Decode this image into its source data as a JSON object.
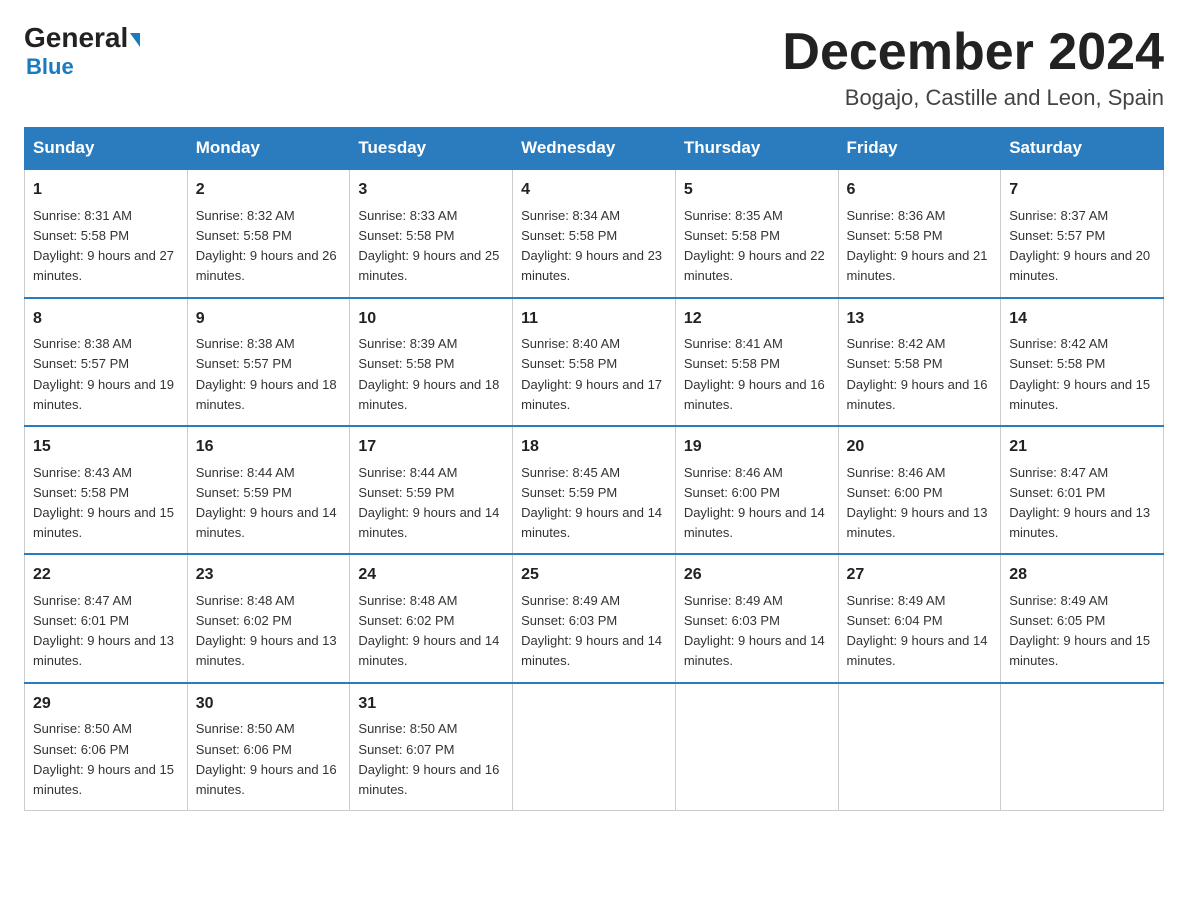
{
  "header": {
    "logo_general": "General",
    "logo_blue": "Blue",
    "month_year": "December 2024",
    "location": "Bogajo, Castille and Leon, Spain"
  },
  "days_of_week": [
    "Sunday",
    "Monday",
    "Tuesday",
    "Wednesday",
    "Thursday",
    "Friday",
    "Saturday"
  ],
  "weeks": [
    [
      {
        "day": "1",
        "sunrise": "8:31 AM",
        "sunset": "5:58 PM",
        "daylight": "9 hours and 27 minutes."
      },
      {
        "day": "2",
        "sunrise": "8:32 AM",
        "sunset": "5:58 PM",
        "daylight": "9 hours and 26 minutes."
      },
      {
        "day": "3",
        "sunrise": "8:33 AM",
        "sunset": "5:58 PM",
        "daylight": "9 hours and 25 minutes."
      },
      {
        "day": "4",
        "sunrise": "8:34 AM",
        "sunset": "5:58 PM",
        "daylight": "9 hours and 23 minutes."
      },
      {
        "day": "5",
        "sunrise": "8:35 AM",
        "sunset": "5:58 PM",
        "daylight": "9 hours and 22 minutes."
      },
      {
        "day": "6",
        "sunrise": "8:36 AM",
        "sunset": "5:58 PM",
        "daylight": "9 hours and 21 minutes."
      },
      {
        "day": "7",
        "sunrise": "8:37 AM",
        "sunset": "5:57 PM",
        "daylight": "9 hours and 20 minutes."
      }
    ],
    [
      {
        "day": "8",
        "sunrise": "8:38 AM",
        "sunset": "5:57 PM",
        "daylight": "9 hours and 19 minutes."
      },
      {
        "day": "9",
        "sunrise": "8:38 AM",
        "sunset": "5:57 PM",
        "daylight": "9 hours and 18 minutes."
      },
      {
        "day": "10",
        "sunrise": "8:39 AM",
        "sunset": "5:58 PM",
        "daylight": "9 hours and 18 minutes."
      },
      {
        "day": "11",
        "sunrise": "8:40 AM",
        "sunset": "5:58 PM",
        "daylight": "9 hours and 17 minutes."
      },
      {
        "day": "12",
        "sunrise": "8:41 AM",
        "sunset": "5:58 PM",
        "daylight": "9 hours and 16 minutes."
      },
      {
        "day": "13",
        "sunrise": "8:42 AM",
        "sunset": "5:58 PM",
        "daylight": "9 hours and 16 minutes."
      },
      {
        "day": "14",
        "sunrise": "8:42 AM",
        "sunset": "5:58 PM",
        "daylight": "9 hours and 15 minutes."
      }
    ],
    [
      {
        "day": "15",
        "sunrise": "8:43 AM",
        "sunset": "5:58 PM",
        "daylight": "9 hours and 15 minutes."
      },
      {
        "day": "16",
        "sunrise": "8:44 AM",
        "sunset": "5:59 PM",
        "daylight": "9 hours and 14 minutes."
      },
      {
        "day": "17",
        "sunrise": "8:44 AM",
        "sunset": "5:59 PM",
        "daylight": "9 hours and 14 minutes."
      },
      {
        "day": "18",
        "sunrise": "8:45 AM",
        "sunset": "5:59 PM",
        "daylight": "9 hours and 14 minutes."
      },
      {
        "day": "19",
        "sunrise": "8:46 AM",
        "sunset": "6:00 PM",
        "daylight": "9 hours and 14 minutes."
      },
      {
        "day": "20",
        "sunrise": "8:46 AM",
        "sunset": "6:00 PM",
        "daylight": "9 hours and 13 minutes."
      },
      {
        "day": "21",
        "sunrise": "8:47 AM",
        "sunset": "6:01 PM",
        "daylight": "9 hours and 13 minutes."
      }
    ],
    [
      {
        "day": "22",
        "sunrise": "8:47 AM",
        "sunset": "6:01 PM",
        "daylight": "9 hours and 13 minutes."
      },
      {
        "day": "23",
        "sunrise": "8:48 AM",
        "sunset": "6:02 PM",
        "daylight": "9 hours and 13 minutes."
      },
      {
        "day": "24",
        "sunrise": "8:48 AM",
        "sunset": "6:02 PM",
        "daylight": "9 hours and 14 minutes."
      },
      {
        "day": "25",
        "sunrise": "8:49 AM",
        "sunset": "6:03 PM",
        "daylight": "9 hours and 14 minutes."
      },
      {
        "day": "26",
        "sunrise": "8:49 AM",
        "sunset": "6:03 PM",
        "daylight": "9 hours and 14 minutes."
      },
      {
        "day": "27",
        "sunrise": "8:49 AM",
        "sunset": "6:04 PM",
        "daylight": "9 hours and 14 minutes."
      },
      {
        "day": "28",
        "sunrise": "8:49 AM",
        "sunset": "6:05 PM",
        "daylight": "9 hours and 15 minutes."
      }
    ],
    [
      {
        "day": "29",
        "sunrise": "8:50 AM",
        "sunset": "6:06 PM",
        "daylight": "9 hours and 15 minutes."
      },
      {
        "day": "30",
        "sunrise": "8:50 AM",
        "sunset": "6:06 PM",
        "daylight": "9 hours and 16 minutes."
      },
      {
        "day": "31",
        "sunrise": "8:50 AM",
        "sunset": "6:07 PM",
        "daylight": "9 hours and 16 minutes."
      },
      {
        "day": "",
        "sunrise": "",
        "sunset": "",
        "daylight": ""
      },
      {
        "day": "",
        "sunrise": "",
        "sunset": "",
        "daylight": ""
      },
      {
        "day": "",
        "sunrise": "",
        "sunset": "",
        "daylight": ""
      },
      {
        "day": "",
        "sunrise": "",
        "sunset": "",
        "daylight": ""
      }
    ]
  ]
}
